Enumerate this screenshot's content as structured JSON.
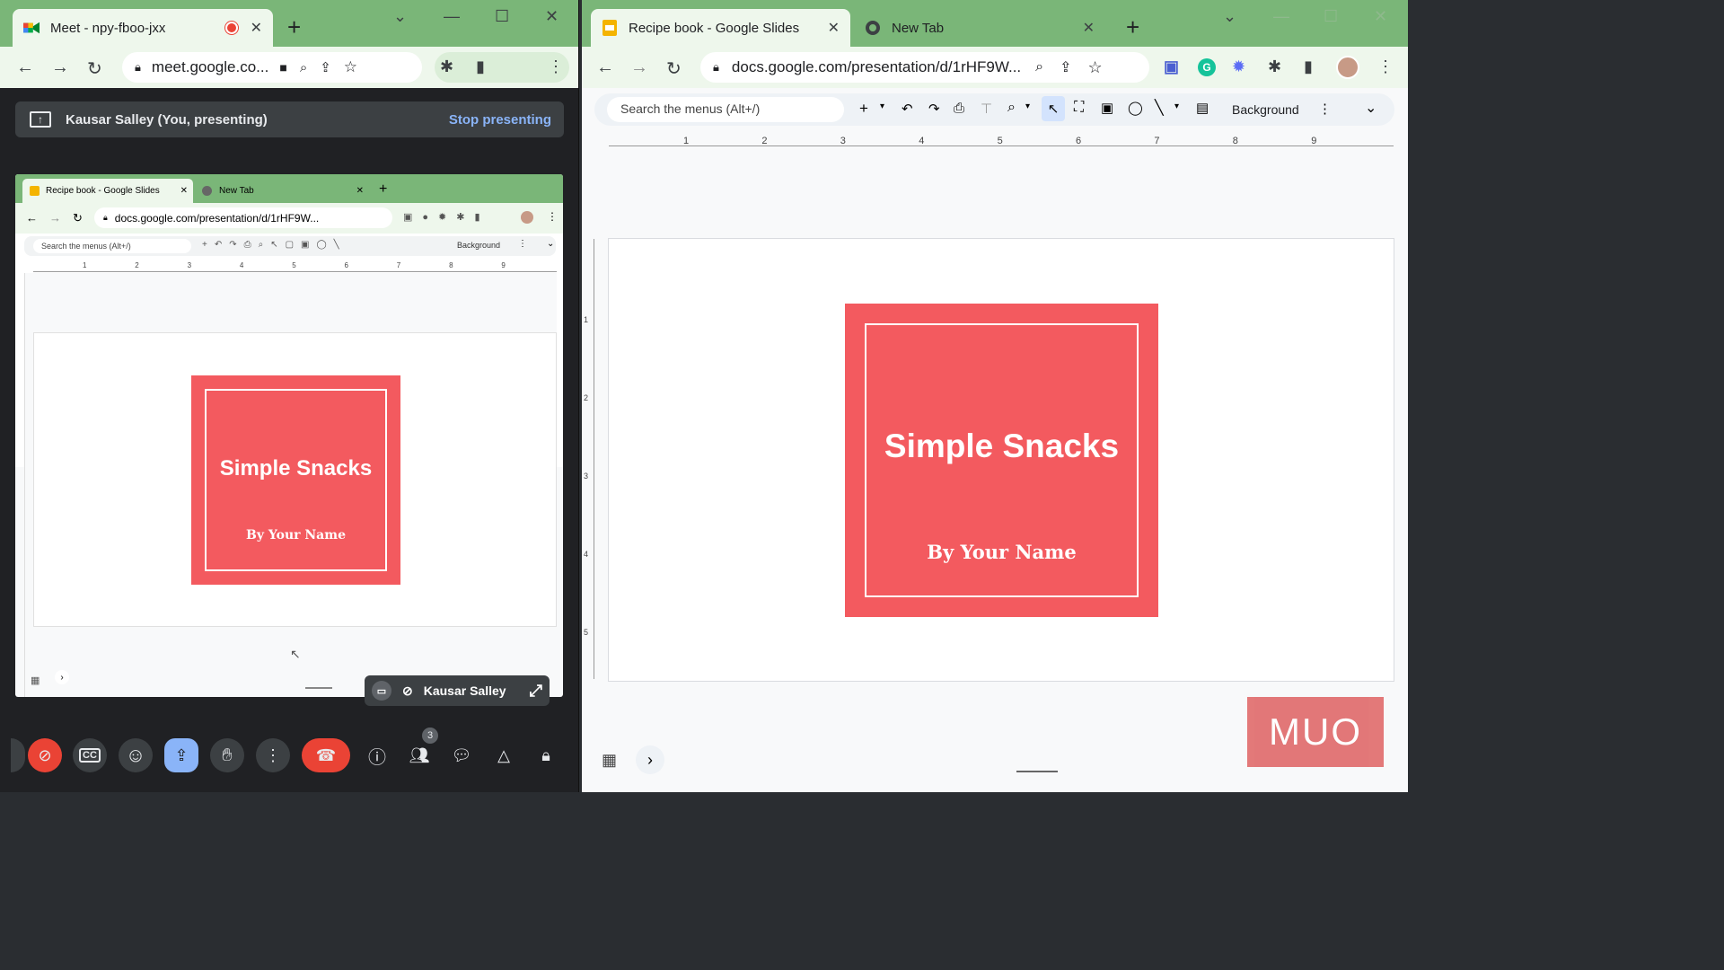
{
  "left_window": {
    "tab_title": "Meet - npy-fboo-jxx",
    "url": "meet.google.co...",
    "presenting_label": "Kausar Salley (You, presenting)",
    "stop_presenting": "Stop presenting",
    "self_tile_name": "Kausar Salley",
    "participants_badge": "3",
    "colors": {
      "chrome": "#7ab678",
      "meet_bg": "#202124",
      "end_call": "#ea4335",
      "present_active": "#8ab4f8"
    }
  },
  "mini_browser": {
    "tab_active": "Recipe book - Google Slides",
    "tab_other": "New Tab",
    "url": "docs.google.com/presentation/d/1rHF9W...",
    "search_placeholder": "Search the menus (Alt+/)",
    "background_btn": "Background",
    "ruler_ticks": [
      "1",
      "2",
      "3",
      "4",
      "5",
      "6",
      "7",
      "8",
      "9"
    ]
  },
  "right_window": {
    "tab_active": "Recipe book - Google Slides",
    "tab_other": "New Tab",
    "url": "docs.google.com/presentation/d/1rHF9W...",
    "search_placeholder": "Search the menus (Alt+/)",
    "background_btn": "Background",
    "ruler_ticks": [
      "1",
      "2",
      "3",
      "4",
      "5",
      "6",
      "7",
      "8",
      "9"
    ],
    "vruler_ticks": [
      "1",
      "2",
      "3",
      "4",
      "5"
    ]
  },
  "slide": {
    "title": "Simple Snacks",
    "subtitle": "By Your Name",
    "color": "#f35a5f"
  },
  "watermark": "MUO"
}
